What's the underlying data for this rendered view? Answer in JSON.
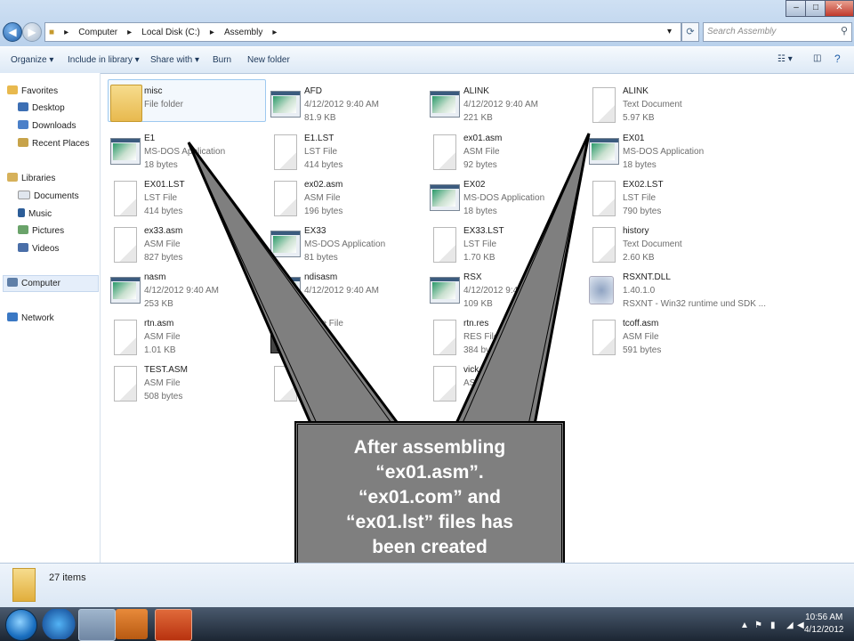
{
  "window": {
    "breadcrumb": [
      "Computer",
      "Local Disk (C:)",
      "Assembly"
    ],
    "search_placeholder": "Search Assembly",
    "controls": {
      "minimize": "–",
      "maximize": "□",
      "close": "✕"
    }
  },
  "toolbar": {
    "organize": "Organize ▾",
    "include_in_library": "Include in library ▾",
    "share_with": "Share with ▾",
    "burn": "Burn",
    "new_folder": "New folder"
  },
  "navigation": {
    "favorites": "Favorites",
    "desktop": "Desktop",
    "downloads": "Downloads",
    "recent_places": "Recent Places",
    "libraries": "Libraries",
    "documents": "Documents",
    "music": "Music",
    "pictures": "Pictures",
    "videos": "Videos",
    "computer": "Computer",
    "network": "Network"
  },
  "files": [
    {
      "name": "misc",
      "type": "File folder",
      "size": "",
      "icon": "folder"
    },
    {
      "name": "AFD",
      "type": "4/12/2012 9:40 AM",
      "size": "81.9 KB",
      "icon": "app"
    },
    {
      "name": "ALINK",
      "type": "4/12/2012 9:40 AM",
      "size": "221 KB",
      "icon": "app"
    },
    {
      "name": "ALINK",
      "type": "Text Document",
      "size": "5.97 KB",
      "icon": "doc"
    },
    {
      "name": "E1",
      "type": "MS-DOS Application",
      "size": "18 bytes",
      "icon": "app"
    },
    {
      "name": "E1.LST",
      "type": "LST File",
      "size": "414 bytes",
      "icon": "doc"
    },
    {
      "name": "ex01.asm",
      "type": "ASM File",
      "size": "92 bytes",
      "icon": "doc"
    },
    {
      "name": "EX01",
      "type": "MS-DOS Application",
      "size": "18 bytes",
      "icon": "app"
    },
    {
      "name": "EX01.LST",
      "type": "LST File",
      "size": "414 bytes",
      "icon": "doc"
    },
    {
      "name": "ex02.asm",
      "type": "ASM File",
      "size": "196 bytes",
      "icon": "doc"
    },
    {
      "name": "EX02",
      "type": "MS-DOS Application",
      "size": "18 bytes",
      "icon": "app"
    },
    {
      "name": "EX02.LST",
      "type": "LST File",
      "size": "790 bytes",
      "icon": "doc"
    },
    {
      "name": "ex33.asm",
      "type": "ASM File",
      "size": "827 bytes",
      "icon": "doc"
    },
    {
      "name": "EX33",
      "type": "MS-DOS Application",
      "size": "81 bytes",
      "icon": "app"
    },
    {
      "name": "EX33.LST",
      "type": "LST File",
      "size": "1.70 KB",
      "icon": "doc"
    },
    {
      "name": "history",
      "type": "Text Document",
      "size": "2.60 KB",
      "icon": "doc"
    },
    {
      "name": "nasm",
      "type": "4/12/2012 9:40 AM",
      "size": "253 KB",
      "icon": "app"
    },
    {
      "name": "ndisasm",
      "type": "4/12/2012 9:40 AM",
      "size": "",
      "icon": "app"
    },
    {
      "name": "RSX",
      "type": "4/12/2012 9:40 AM",
      "size": "109 KB",
      "icon": "app"
    },
    {
      "name": "RSXNT.DLL",
      "type": "1.40.1.0",
      "size": "RSXNT - Win32 runtime und SDK ...",
      "icon": "dll"
    },
    {
      "name": "rtn.asm",
      "type": "ASM File",
      "size": "1.01 KB",
      "icon": "doc"
    },
    {
      "name": "",
      "type": "ource File",
      "size": "",
      "icon": "rc"
    },
    {
      "name": "rtn.res",
      "type": "RES File",
      "size": "384 bytes",
      "icon": "doc"
    },
    {
      "name": "tcoff.asm",
      "type": "ASM File",
      "size": "591 bytes",
      "icon": "doc"
    },
    {
      "name": "TEST.ASM",
      "type": "ASM File",
      "size": "508 bytes",
      "icon": "doc"
    },
    {
      "name": "TE",
      "type": "OB",
      "size": "405 b",
      "icon": "doc"
    },
    {
      "name": "vick",
      "type": "AS",
      "size": "",
      "icon": "doc"
    }
  ],
  "rc_badge": ".RC",
  "callout": {
    "text": "After assembling\n“ex01.asm”.\n“ex01.com” and\n“ex01.lst” files has\nbeen created"
  },
  "status": {
    "count": "27 items"
  },
  "taskbar": {
    "time": "10:56 AM",
    "date": "4/12/2012"
  },
  "colors": {
    "callout_fill": "#7f7f7f",
    "callout_text": "#ffffff",
    "explorer_accent": "#1e395b"
  }
}
